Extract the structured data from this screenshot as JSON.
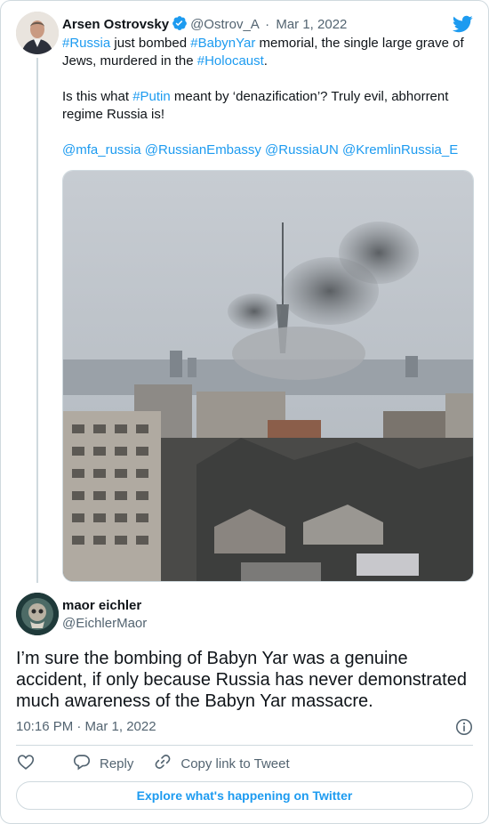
{
  "parent_tweet": {
    "author_name": "Arsen Ostrovsky",
    "handle": "@Ostrov_A",
    "separator": "·",
    "date": "Mar 1, 2022",
    "text": {
      "l1_tag1": "#Russia",
      "l1_t1": " just bombed ",
      "l1_tag2": "#BabynYar",
      "l1_t2": " memorial, the single large grave of Jews, murdered in the ",
      "l1_tag3": "#Holocaust",
      "l1_t3": ".",
      "l2_t1": "Is this what ",
      "l2_tag1": "#Putin",
      "l2_t2": " meant by ‘denazification’? Truly evil, abhorrent regime Russia is!",
      "mention1": "@mfa_russia",
      "mention2": "@RussianEmbassy",
      "mention3": "@RussiaUN",
      "mention4": "@KremlinRussia_E"
    }
  },
  "main_tweet": {
    "author_name": "maor eichler",
    "handle": "@EichlerMaor",
    "text": "I’m sure the bombing of Babyn Yar was a genuine accident, if only because Russia has never demonstrated much awareness of the Babyn Yar massacre.",
    "time": "10:16 PM · Mar 1, 2022"
  },
  "actions": {
    "reply": "Reply",
    "copy_link": "Copy link to Tweet"
  },
  "explore_label": "Explore what's happening on Twitter",
  "colors": {
    "accent": "#1d9bf0",
    "text": "#0f1419",
    "muted": "#536471",
    "border": "#cfd9de"
  },
  "icons": [
    "verified-badge-icon",
    "twitter-bird-icon",
    "heart-icon",
    "reply-icon",
    "link-icon",
    "info-icon"
  ]
}
